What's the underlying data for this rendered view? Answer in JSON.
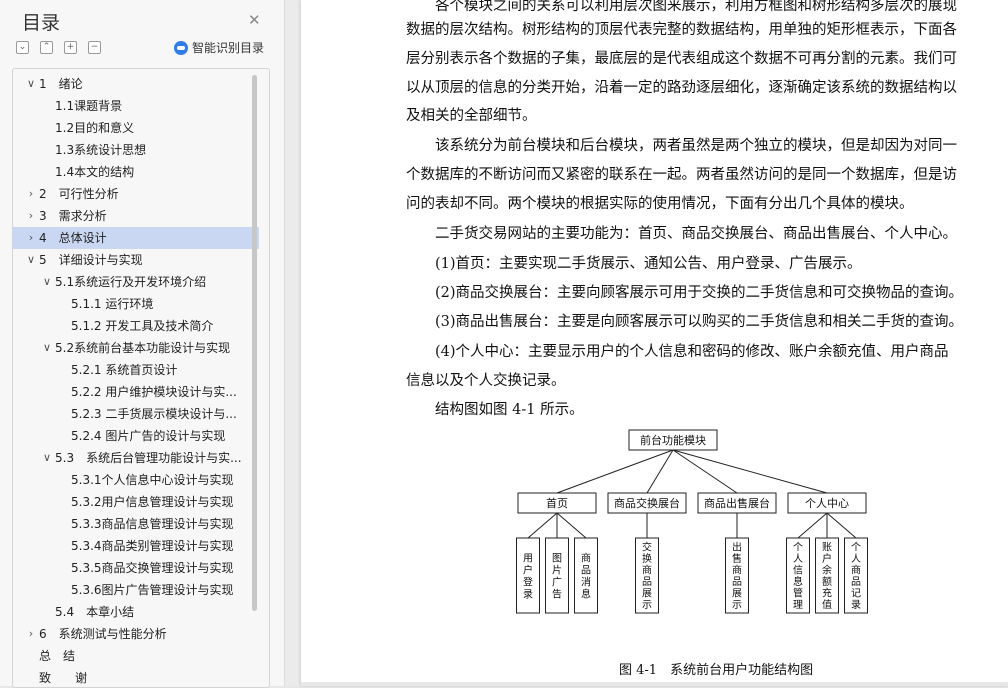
{
  "toc": {
    "title": "目录",
    "ai_label": "智能识别目录",
    "items": [
      {
        "label": "1　绪论",
        "chev": "v"
      },
      {
        "label": "1.1课题背景"
      },
      {
        "label": "1.2目的和意义"
      },
      {
        "label": "1.3系统设计思想"
      },
      {
        "label": "1.4本文的结构"
      },
      {
        "label": "2　可行性分析",
        "chev": ">"
      },
      {
        "label": "3　需求分析",
        "chev": ">"
      },
      {
        "label": "4　总体设计",
        "chev": ">",
        "selected": true
      },
      {
        "label": "5　详细设计与实现",
        "chev": "v"
      },
      {
        "label": "5.1系统运行及开发环境介绍",
        "chev": "v"
      },
      {
        "label": "5.1.1 运行环境"
      },
      {
        "label": "5.1.2 开发工具及技术简介"
      },
      {
        "label": "5.2系统前台基本功能设计与实现",
        "chev": "v"
      },
      {
        "label": "5.2.1 系统首页设计"
      },
      {
        "label": "5.2.2 用户维护模块设计与实..."
      },
      {
        "label": "5.2.3 二手货展示模块设计与..."
      },
      {
        "label": "5.2.4 图片广告的设计与实现"
      },
      {
        "label": "5.3　系统后台管理功能设计与实...",
        "chev": "v"
      },
      {
        "label": "5.3.1个人信息中心设计与实现"
      },
      {
        "label": "5.3.2用户信息管理设计与实现"
      },
      {
        "label": "5.3.3商品信息管理设计与实现"
      },
      {
        "label": "5.3.4商品类别管理设计与实现"
      },
      {
        "label": "5.3.5商品交换管理设计与实现"
      },
      {
        "label": "5.3.6图片广告管理设计与实现"
      },
      {
        "label": "5.4　本章小结"
      },
      {
        "label": "6　系统测试与性能分析",
        "chev": ">"
      },
      {
        "label": "总　结"
      },
      {
        "label": "致　　谢"
      }
    ]
  },
  "doc": {
    "paragraphs": [
      "　　各个模块之间的关系可以利用层次图来展示，利用方框图和树形结构多层次的展现",
      "数据的层次结构。树形结构的顶层代表完整的数据结构，用单独的矩形框表示，下面各",
      "层分别表示各个数据的子集，最底层的是代表组成这个数据不可再分割的元素。我们可",
      "以从顶层的信息的分类开始，沿着一定的路劲逐层细化，逐渐确定该系统的数据结构以",
      "及相关的全部细节。",
      "　　该系统分为前台模块和后台模块，两者虽然是两个独立的模块，但是却因为对同一",
      "个数据库的不断访问而又紧密的联系在一起。两者虽然访问的是同一个数据库，但是访",
      "问的表却不同。两个模块的根据实际的使用情况，下面有分出几个具体的模块。",
      "　　二手货交易网站的主要功能为：首页、商品交换展台、商品出售展台、个人中心。",
      "　　(1)首页：主要实现二手货展示、通知公告、用户登录、广告展示。",
      "　　(2)商品交换展台：主要向顾客展示可用于交换的二手货信息和可交换物品的查询。",
      "　　(3)商品出售展台：主要是向顾客展示可以购买的二手货信息和相关二手货的查询。",
      "　　(4)个人中心：主要显示用户的个人信息和密码的修改、账户余额充值、用户商品",
      "信息以及个人交换记录。",
      "　　结构图如图 4-1 所示。"
    ],
    "figure_caption": "图 4-1　系统前台用户功能结构图",
    "diagram": {
      "root": "前台功能模块",
      "modules": [
        {
          "name": "首页",
          "children": [
            "用户登录",
            "图片广告",
            "商品消息"
          ]
        },
        {
          "name": "商品交换展台",
          "children": [
            "交换商品展示"
          ]
        },
        {
          "name": "商品出售展台",
          "children": [
            "出售商品展示"
          ]
        },
        {
          "name": "个人中心",
          "children": [
            "个人信息管理",
            "账户余额充值",
            "个人商品记录"
          ]
        }
      ]
    }
  }
}
